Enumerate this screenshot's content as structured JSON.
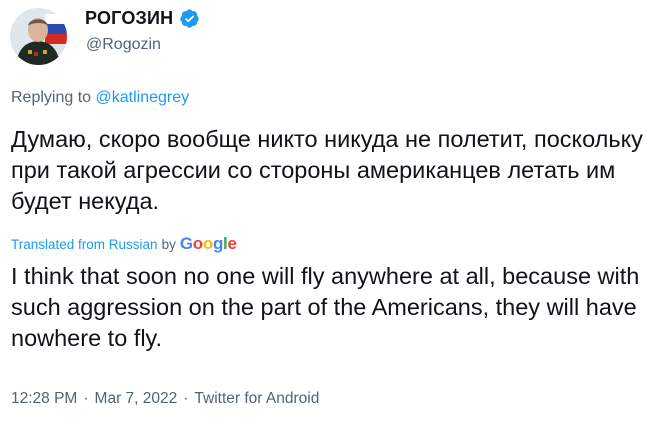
{
  "author": {
    "display_name": "РОГОЗИН",
    "handle": "@Rogozin"
  },
  "reply": {
    "prefix": "Replying to ",
    "mention": "@katlinegrey"
  },
  "tweet": {
    "original_text": "Думаю, скоро вообще никто никуда не полетит, поскольку при такой агрессии со стороны американцев летать им будет некуда.",
    "translated_label": "Translated from Russian",
    "by_label": "by",
    "google_brand": "Google",
    "translation_text": "I think that soon no one will fly anywhere at all, because with such aggression on the part of the Americans, they will have nowhere to fly."
  },
  "meta": {
    "time": "12:28 PM",
    "date": "Mar 7, 2022",
    "source": "Twitter for Android",
    "separator": "·"
  },
  "colors": {
    "link": "#1d9bf0",
    "secondary_text": "#536471",
    "primary_text": "#0f1419"
  },
  "icons": {
    "verified": "verified-badge-icon",
    "avatar": "profile-photo"
  }
}
